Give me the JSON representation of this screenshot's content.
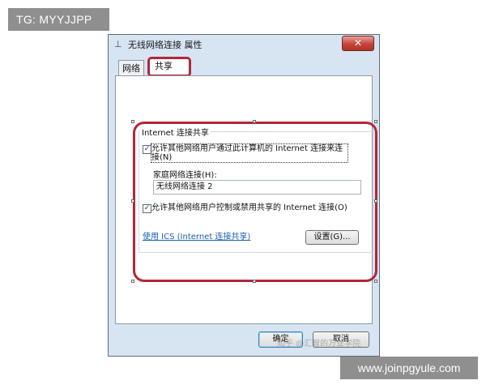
{
  "overlays": {
    "tg_badge": "TG: MYYJJPP",
    "url_badge": "www.joinpgyule.com",
    "watermark": "知乎 @汇智的万业学院"
  },
  "window": {
    "title": "无线网络连接 属性",
    "close_label": "✕"
  },
  "tabs": [
    {
      "label": "网络",
      "active": false
    },
    {
      "label": "共享",
      "active": true
    }
  ],
  "group": {
    "title": "Internet 连接共享"
  },
  "checkbox1": {
    "checked": true,
    "mark": "✓",
    "label": "允许其他网络用户通过此计算机的 Internet 连接来连接(N)"
  },
  "home_network": {
    "label": "家庭网络连接(H):",
    "value": "无线网络连接 2"
  },
  "checkbox2": {
    "checked": true,
    "mark": "✓",
    "label": "允许其他网络用户控制或禁用共享的 Internet 连接(O)"
  },
  "ics_link": "使用 ICS (Internet 连接共享)",
  "buttons": {
    "settings": "设置(G)...",
    "ok": "确定",
    "cancel": "取消"
  },
  "colors": {
    "highlight": "#b3263a",
    "close_button": "#c6443a",
    "link": "#1a5fb4"
  }
}
